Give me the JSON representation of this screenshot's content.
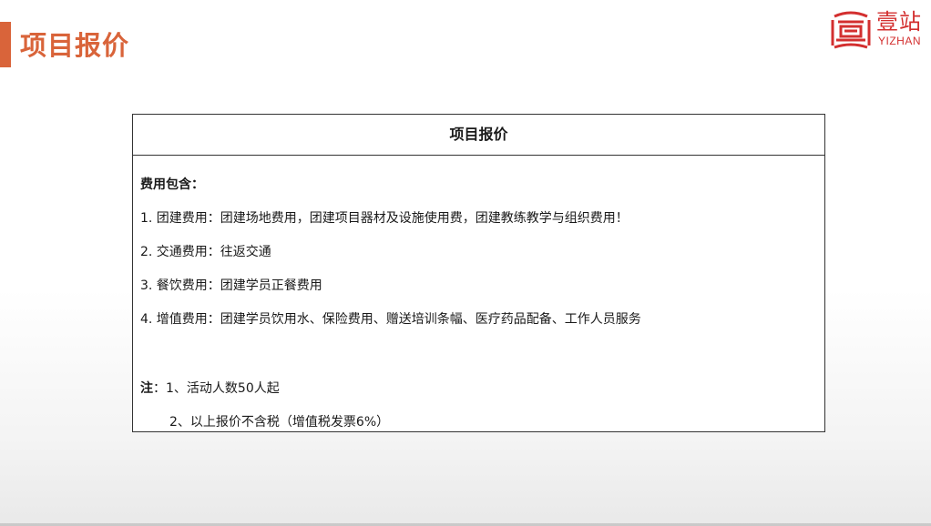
{
  "page": {
    "title": "项目报价"
  },
  "logo": {
    "text_cn": "壹站",
    "text_en": "YIZHAN",
    "brand_color": "#d32f2f"
  },
  "accent_color": "#d9643a",
  "card": {
    "header": "项目报价",
    "section_label": "费用包含：",
    "items": [
      "1.  团建费用：团建场地费用，团建项目器材及设施使用费，团建教练教学与组织费用！",
      "2.  交通费用：往返交通",
      "3.  餐饮费用：团建学员正餐费用",
      "4.  增值费用：团建学员饮用水、保险费用、赠送培训条幅、医疗药品配备、工作人员服务"
    ],
    "note_label": "注",
    "note_lines": [
      "：1、活动人数50人起",
      "2、以上报价不含税（增值税发票6%）"
    ]
  }
}
